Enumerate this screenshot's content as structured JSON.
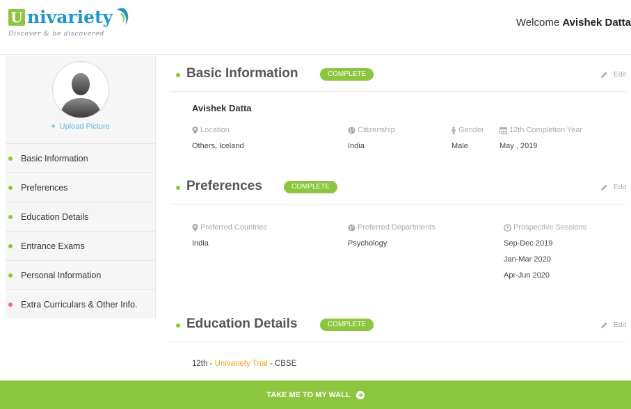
{
  "header": {
    "logo_initial": "U",
    "logo_rest": "nivariety",
    "logo_tagline": "Discover & be discovered",
    "welcome_prefix": "Welcome",
    "user_name": "Avishek Datta"
  },
  "sidebar": {
    "upload_plus": "+",
    "upload_label": "Upload Picture",
    "items": [
      {
        "label": "Basic Information",
        "status": "complete"
      },
      {
        "label": "Preferences",
        "status": "complete"
      },
      {
        "label": "Education Details",
        "status": "complete"
      },
      {
        "label": "Entrance Exams",
        "status": "complete"
      },
      {
        "label": "Personal Information",
        "status": "complete"
      },
      {
        "label": "Extra Curriculars & Other Info.",
        "status": "incomplete"
      }
    ]
  },
  "basic": {
    "title": "Basic Information",
    "badge": "COMPLETE",
    "edit": "Edit",
    "name": "Avishek Datta",
    "fields": [
      {
        "label": "Location",
        "value": "Others, Iceland",
        "icon": "map-marker-icon"
      },
      {
        "label": "Citizenship",
        "value": "India",
        "icon": "globe-icon"
      },
      {
        "label": "Gender",
        "value": "Male",
        "icon": "person-icon"
      },
      {
        "label": "12th Completion Year",
        "value": "May , 2019",
        "icon": "calendar-icon"
      }
    ]
  },
  "preferences": {
    "title": "Preferences",
    "badge": "COMPLETE",
    "edit": "Edit",
    "countries_label": "Preferred Countries",
    "countries": [
      "India"
    ],
    "departments_label": "Preferred Departments",
    "departments": [
      "Psychology"
    ],
    "sessions_label": "Prospective Sessions",
    "sessions": [
      "Sep-Dec 2019",
      "Jan-Mar 2020",
      "Apr-Jun 2020"
    ]
  },
  "education": {
    "title": "Education Details",
    "badge": "COMPLETE",
    "edit": "Edit",
    "row_prefix": "12th",
    "separator": " - ",
    "school": "Univariety Trial",
    "board": "CBSE"
  },
  "footer": {
    "cta": "TAKE ME TO MY WALL"
  },
  "colors": {
    "accent_green": "#8cc63f",
    "brand_blue": "#1f95c9",
    "link_orange": "#f5a623",
    "incomplete_red": "#ef6b7f"
  }
}
